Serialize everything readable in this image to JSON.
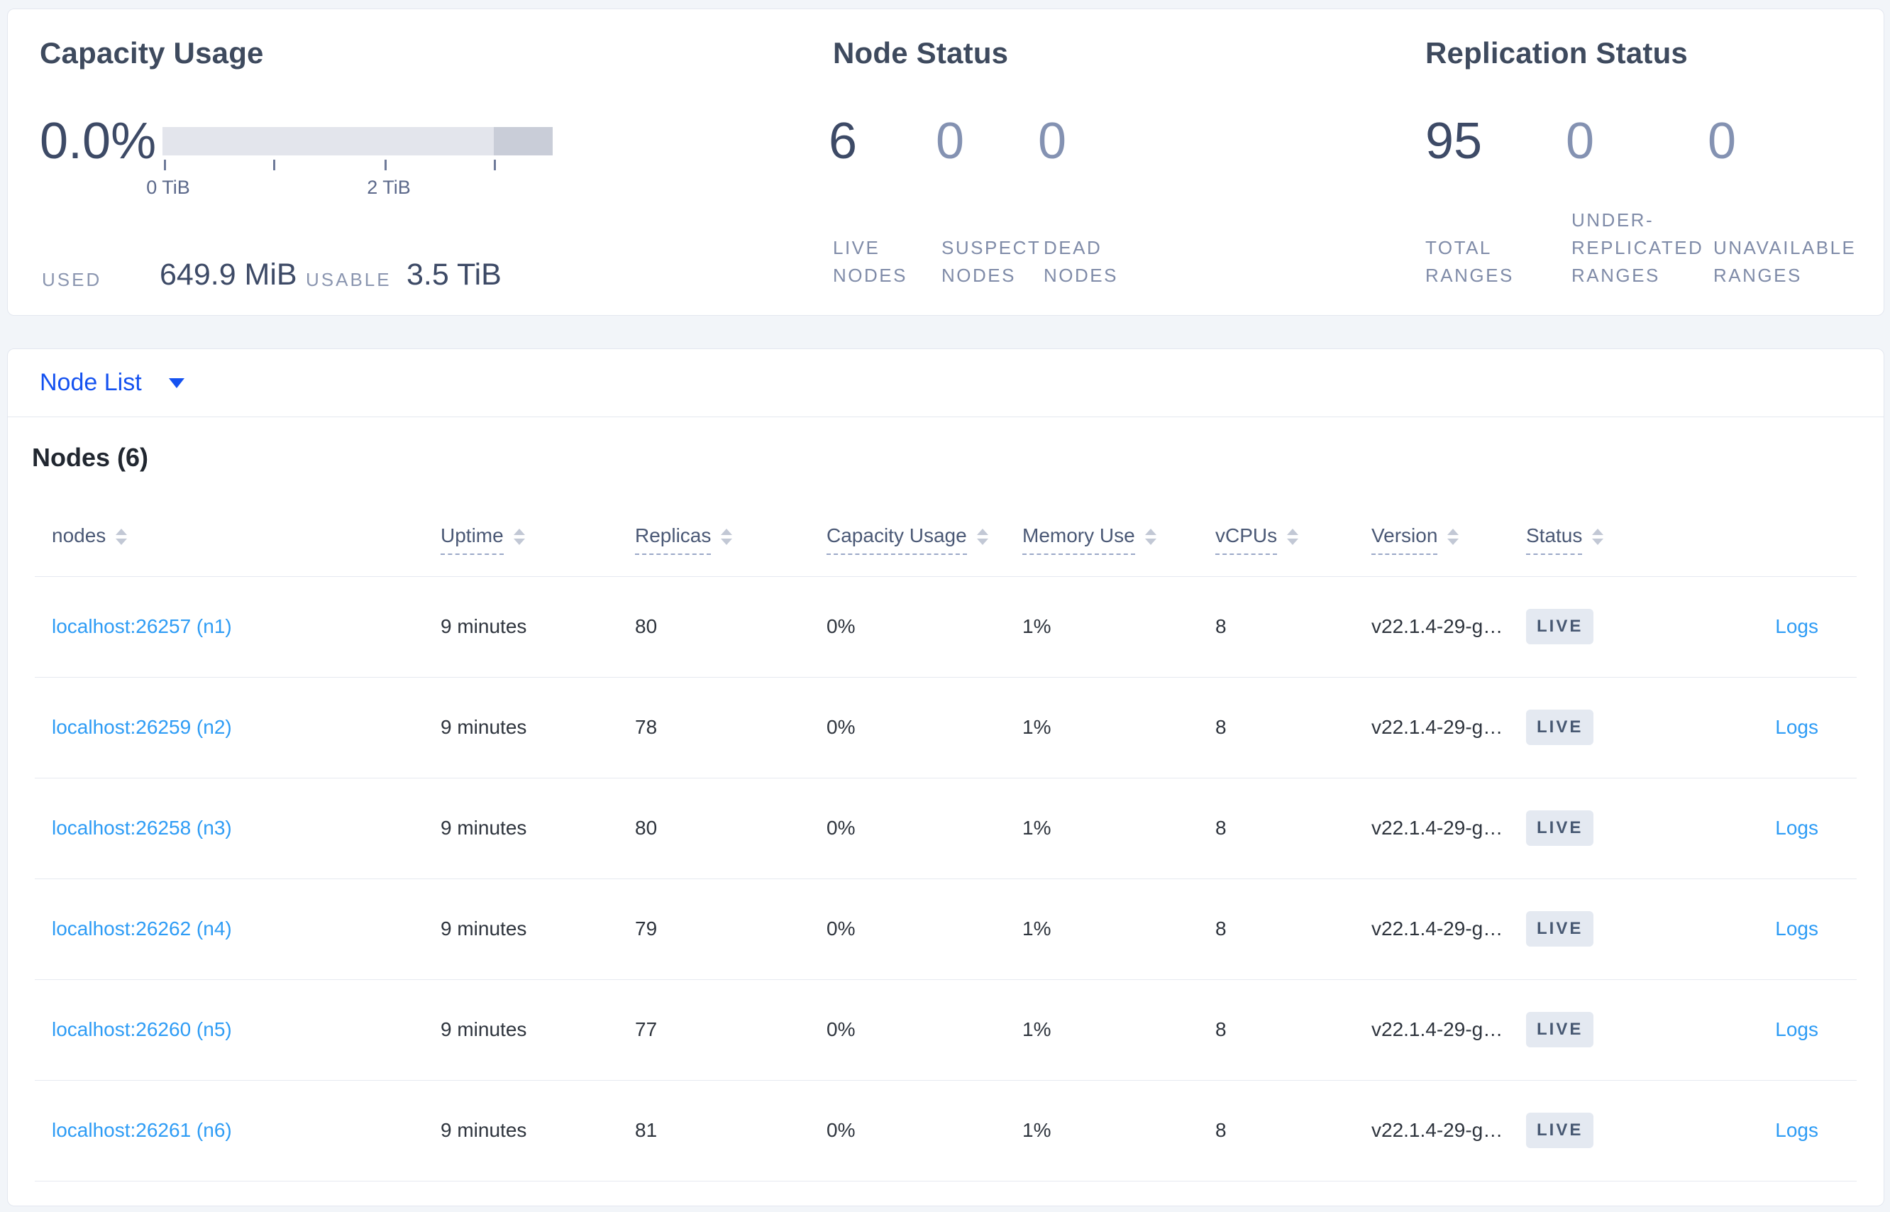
{
  "summary": {
    "capacity_usage": {
      "title": "Capacity Usage",
      "percent": "0.0%",
      "tick_labels": [
        "0 TiB",
        "2 TiB"
      ],
      "bar": {
        "total_tib": 3.5,
        "tick_interval_tib": 1,
        "used_fraction": 0.0,
        "dark_segment_start_fraction": 0.85
      },
      "used_label": "USED",
      "used_value": "649.9 MiB",
      "usable_label": "USABLE",
      "usable_value": "3.5 TiB"
    },
    "node_status": {
      "title": "Node Status",
      "stats": [
        {
          "value": "6",
          "label": "LIVE NODES"
        },
        {
          "value": "0",
          "label": "SUSPECT NODES"
        },
        {
          "value": "0",
          "label": "DEAD NODES"
        }
      ]
    },
    "replication_status": {
      "title": "Replication Status",
      "stats": [
        {
          "value": "95",
          "label": "TOTAL RANGES"
        },
        {
          "value": "0",
          "label": "UNDER-REPLICATED RANGES"
        },
        {
          "value": "0",
          "label": "UNAVAILABLE RANGES"
        }
      ]
    }
  },
  "node_list_dropdown": {
    "label": "Node List"
  },
  "nodes_table": {
    "title": "Nodes (6)",
    "columns": [
      "nodes",
      "Uptime",
      "Replicas",
      "Capacity Usage",
      "Memory Use",
      "vCPUs",
      "Version",
      "Status"
    ],
    "logs_label": "Logs",
    "rows": [
      {
        "address": "localhost:26257 (n1)",
        "uptime": "9 minutes",
        "replicas": "80",
        "capacity_usage": "0%",
        "memory_use": "1%",
        "vcpus": "8",
        "version": "v22.1.4-29-g…",
        "status": "LIVE"
      },
      {
        "address": "localhost:26259 (n2)",
        "uptime": "9 minutes",
        "replicas": "78",
        "capacity_usage": "0%",
        "memory_use": "1%",
        "vcpus": "8",
        "version": "v22.1.4-29-g…",
        "status": "LIVE"
      },
      {
        "address": "localhost:26258 (n3)",
        "uptime": "9 minutes",
        "replicas": "80",
        "capacity_usage": "0%",
        "memory_use": "1%",
        "vcpus": "8",
        "version": "v22.1.4-29-g…",
        "status": "LIVE"
      },
      {
        "address": "localhost:26262 (n4)",
        "uptime": "9 minutes",
        "replicas": "79",
        "capacity_usage": "0%",
        "memory_use": "1%",
        "vcpus": "8",
        "version": "v22.1.4-29-g…",
        "status": "LIVE"
      },
      {
        "address": "localhost:26260 (n5)",
        "uptime": "9 minutes",
        "replicas": "77",
        "capacity_usage": "0%",
        "memory_use": "1%",
        "vcpus": "8",
        "version": "v22.1.4-29-g…",
        "status": "LIVE"
      },
      {
        "address": "localhost:26261 (n6)",
        "uptime": "9 minutes",
        "replicas": "81",
        "capacity_usage": "0%",
        "memory_use": "1%",
        "vcpus": "8",
        "version": "v22.1.4-29-g…",
        "status": "LIVE"
      }
    ]
  },
  "colors": {
    "page_background": "#f2f5f9",
    "card_border": "#e3e7ef",
    "heading_text": "#3e4a5e",
    "stat_strong": "#3d4a66",
    "stat_muted": "#8492b2",
    "stat_caption": "#7f8ba8",
    "dropdown_blue": "#1552f0",
    "link_blue": "#2e9cf5",
    "badge_background": "#e4e9f1",
    "badge_text": "#475872",
    "bar_track": "#e3e5ec",
    "bar_dark_segment": "#c9cdd8",
    "row_separator": "#e6e9f0"
  }
}
